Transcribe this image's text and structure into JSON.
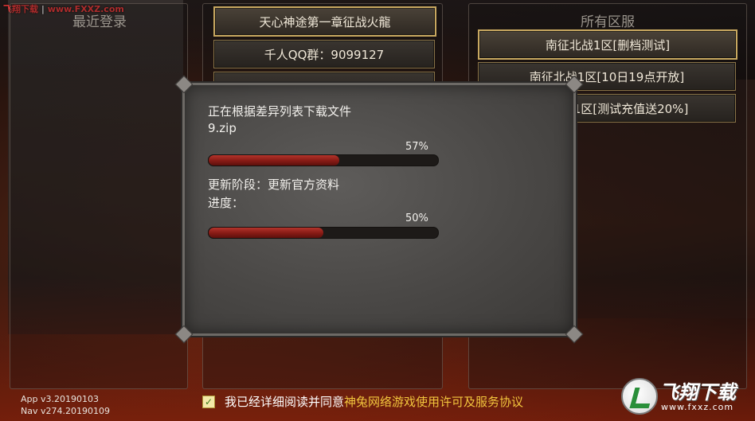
{
  "watermark": {
    "site_name": "飞翔下载",
    "separator": "|",
    "site_url": "www.FXXZ.com"
  },
  "left_panel": {
    "title": "最近登录"
  },
  "middle_panel": {
    "items": [
      {
        "label": "天心神途第一章征战火龍",
        "active": true
      },
      {
        "label": "千人QQ群：9099127",
        "active": false
      },
      {
        "label": "",
        "active": false
      }
    ]
  },
  "right_panel": {
    "title": "所有区服",
    "servers": [
      {
        "label": "南征北战1区[删档测试]",
        "active": true
      },
      {
        "label": "南征北战1区[10日19点开放]",
        "active": false
      },
      {
        "label": "南征北战1区[测试充值送20%]",
        "active": false
      }
    ]
  },
  "update_dialog": {
    "status_line": "正在根据差异列表下载文件",
    "file_name": "9.zip",
    "file_progress": {
      "percent_label": "57%",
      "value": 57
    },
    "stage_line": "更新阶段：更新官方资料",
    "progress_label": "进度：",
    "overall_progress": {
      "percent_label": "50%",
      "value": 50
    }
  },
  "versions": {
    "app": "App v3.20190103",
    "nav": "Nav v274.20190109"
  },
  "agreement": {
    "checked": true,
    "check_mark": "✓",
    "text": "我已经详细阅读并同意",
    "link": "神兔网络游戏使用许可及服务协议"
  },
  "logo": {
    "name": "飞翔下载",
    "url": "www.fxxz.com"
  }
}
